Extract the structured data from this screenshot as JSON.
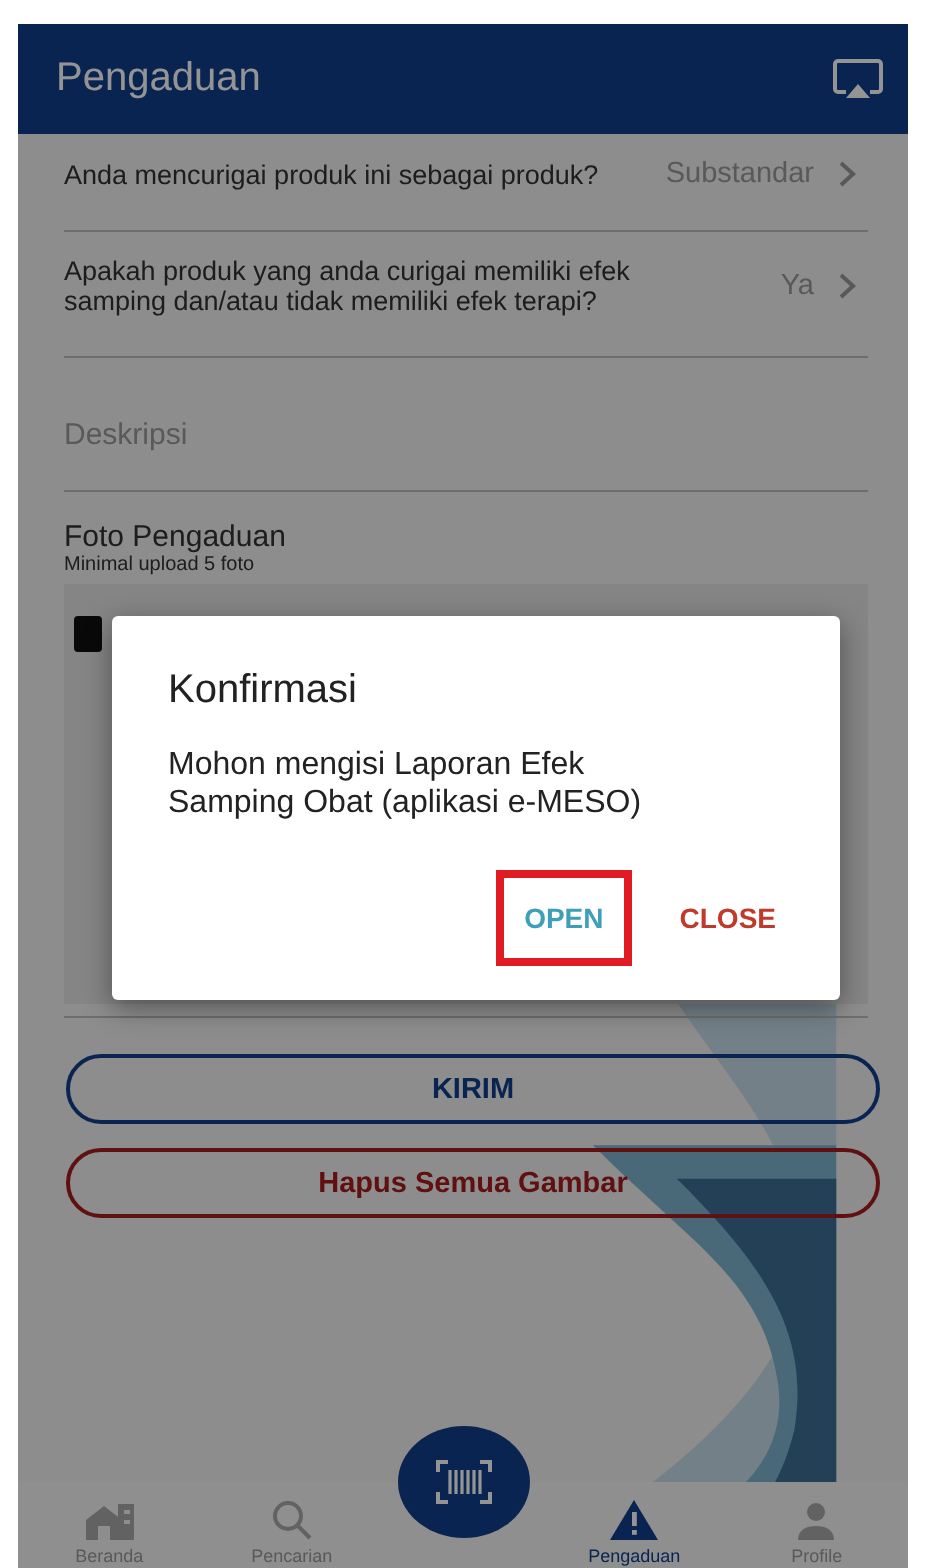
{
  "header": {
    "title": "Pengaduan"
  },
  "rows": [
    {
      "kind": "choice",
      "label": "Anda mencurigai produk ini sebagai produk?",
      "value": "Substandar"
    },
    {
      "kind": "choice",
      "label": "Apakah produk yang anda curigai memiliki efek samping dan/atau tidak memiliki efek terapi?",
      "value": "Ya"
    },
    {
      "kind": "field",
      "placeholder": "Deskripsi"
    }
  ],
  "photos": {
    "title": "Foto Pengaduan",
    "hint": "Minimal upload 5 foto"
  },
  "buttons": [
    {
      "kind": "primary",
      "label": "KIRIM"
    },
    {
      "kind": "danger",
      "label": "Hapus Semua Gambar"
    }
  ],
  "nav": [
    {
      "label": "Beranda",
      "kind": "home",
      "selected": false
    },
    {
      "label": "Pencarian",
      "kind": "search",
      "selected": false
    },
    {
      "label": "Pengaduan",
      "kind": "warning",
      "selected": true
    },
    {
      "label": "Profile",
      "kind": "person",
      "selected": false
    }
  ],
  "dialog": {
    "title": "Konfirmasi",
    "message": "Mohon mengisi Laporan Efek Samping Obat (aplikasi e-MESO)",
    "actions": [
      {
        "kind": "positive",
        "label": "OPEN",
        "highlighted": true
      },
      {
        "kind": "negative",
        "label": "CLOSE",
        "highlighted": false
      }
    ]
  }
}
